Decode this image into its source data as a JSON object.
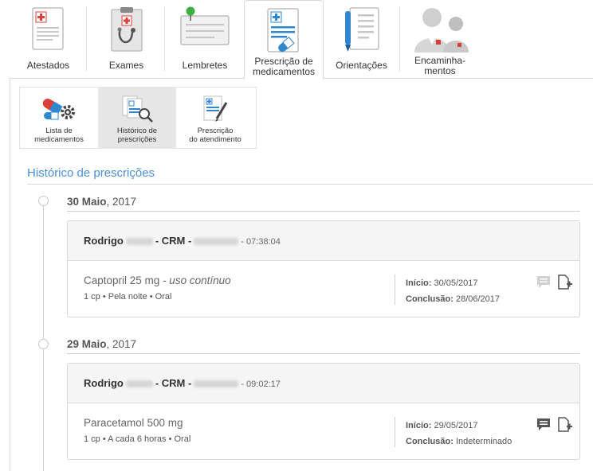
{
  "tabs": [
    {
      "label": "Atestados",
      "icon": "certificate-icon"
    },
    {
      "label": "Exames",
      "icon": "clipboard-stethoscope-icon"
    },
    {
      "label": "Lembretes",
      "icon": "note-pin-icon"
    },
    {
      "label_line1": "Prescrição de",
      "label_line2": "medicamentos",
      "icon": "prescription-icon",
      "active": true
    },
    {
      "label": "Orientações",
      "icon": "document-pen-icon"
    },
    {
      "label_line1": "Encaminha-",
      "label_line2": "mentos",
      "icon": "doctors-icon"
    }
  ],
  "subtabs": [
    {
      "label_line1": "Lista de",
      "label_line2": "medicamentos",
      "icon": "pills-gear-icon"
    },
    {
      "label_line1": "Histórico de",
      "label_line2": "prescrições",
      "icon": "documents-search-icon",
      "active": true
    },
    {
      "label_line1": "Prescrição",
      "label_line2": "do atendimento",
      "icon": "prescription-pen-icon"
    }
  ],
  "section_title": "Histórico de prescrições",
  "entries": [
    {
      "date_day_month": "30 Maio",
      "date_year": ", 2017",
      "doctor": "Rodrigo",
      "crm_label": "- CRM -",
      "time": "- 07:38:04",
      "medication": "Captopril 25 mg",
      "medication_suffix": " - uso contínuo",
      "dosage": "1 cp • Pela noite • Oral",
      "start_label": "Início:",
      "start_value": " 30/05/2017",
      "end_label": "Conclusão:",
      "end_value": " 28/06/2017"
    },
    {
      "date_day_month": "29 Maio",
      "date_year": ", 2017",
      "doctor": "Rodrigo",
      "crm_label": "- CRM -",
      "time": "- 09:02:17",
      "medication": "Paracetamol 500 mg",
      "medication_suffix": "",
      "dosage": "1 cp • A cada 6 horas • Oral",
      "start_label": "Início:",
      "start_value": " 29/05/2017",
      "end_label": "Conclusão:",
      "end_value": " Indeterminado"
    }
  ],
  "colors": {
    "accent": "#4a90d9",
    "red": "#d9403a",
    "green": "#3cb043"
  }
}
